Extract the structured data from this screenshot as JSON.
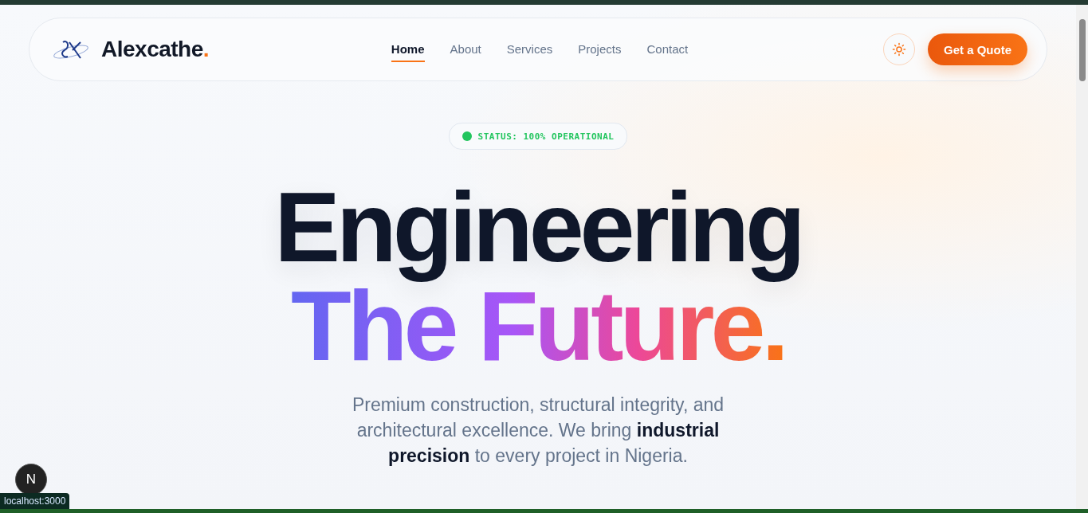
{
  "nav": {
    "brand": "Alexcathe",
    "brand_dot": ".",
    "links": [
      {
        "label": "Home",
        "selected": true
      },
      {
        "label": "About",
        "selected": false
      },
      {
        "label": "Services",
        "selected": false
      },
      {
        "label": "Projects",
        "selected": false
      },
      {
        "label": "Contact",
        "selected": false
      }
    ],
    "cta": "Get a Quote"
  },
  "hero": {
    "status": "STATUS: 100% OPERATIONAL",
    "title_line_1": "Engineering",
    "title_line_2": "The Future.",
    "subtitle": "Premium construction, structural integrity, and architectural excellence. We bring **industrial precision** to every project in Nigeria."
  },
  "dev_badge": "N",
  "status_url": "localhost:3000"
}
